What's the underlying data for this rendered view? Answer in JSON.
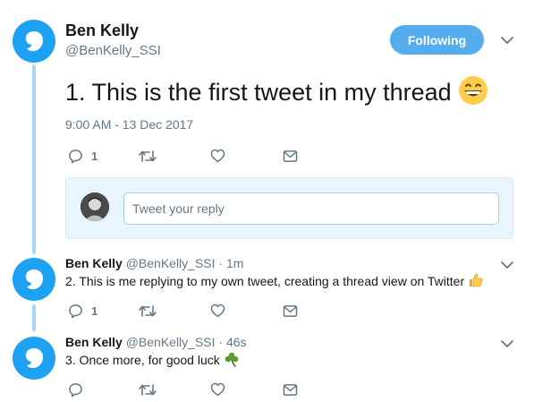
{
  "main_tweet": {
    "name": "Ben Kelly",
    "handle": "@BenKelly_SSI",
    "follow_label": "Following",
    "text": "1. This is the first tweet in my thread",
    "emoji": "grinning-face",
    "timestamp": "9:00 AM - 13 Dec 2017",
    "reply_count": "1"
  },
  "reply_compose": {
    "placeholder": "Tweet your reply"
  },
  "replies": [
    {
      "name": "Ben Kelly",
      "handle": "@BenKelly_SSI",
      "separator": "·",
      "time": "1m",
      "text": "2. This is me replying to my own tweet, creating a thread view on Twitter",
      "emoji": "thumbs-up",
      "reply_count": "1"
    },
    {
      "name": "Ben Kelly",
      "handle": "@BenKelly_SSI",
      "separator": "·",
      "time": "46s",
      "text": "3. Once more, for good luck",
      "emoji": "shamrock",
      "reply_count": ""
    }
  ],
  "icons": {
    "avatar": "user-avatar-icon",
    "reply": "reply-icon",
    "retweet": "retweet-icon",
    "like": "heart-icon",
    "dm": "envelope-icon",
    "more": "chevron-down-icon"
  },
  "colors": {
    "accent": "#1da1f2",
    "follow_button": "#55acee",
    "thread_line": "#a9d6f5",
    "muted": "#657786",
    "reply_box_bg": "#e8f5fd"
  }
}
